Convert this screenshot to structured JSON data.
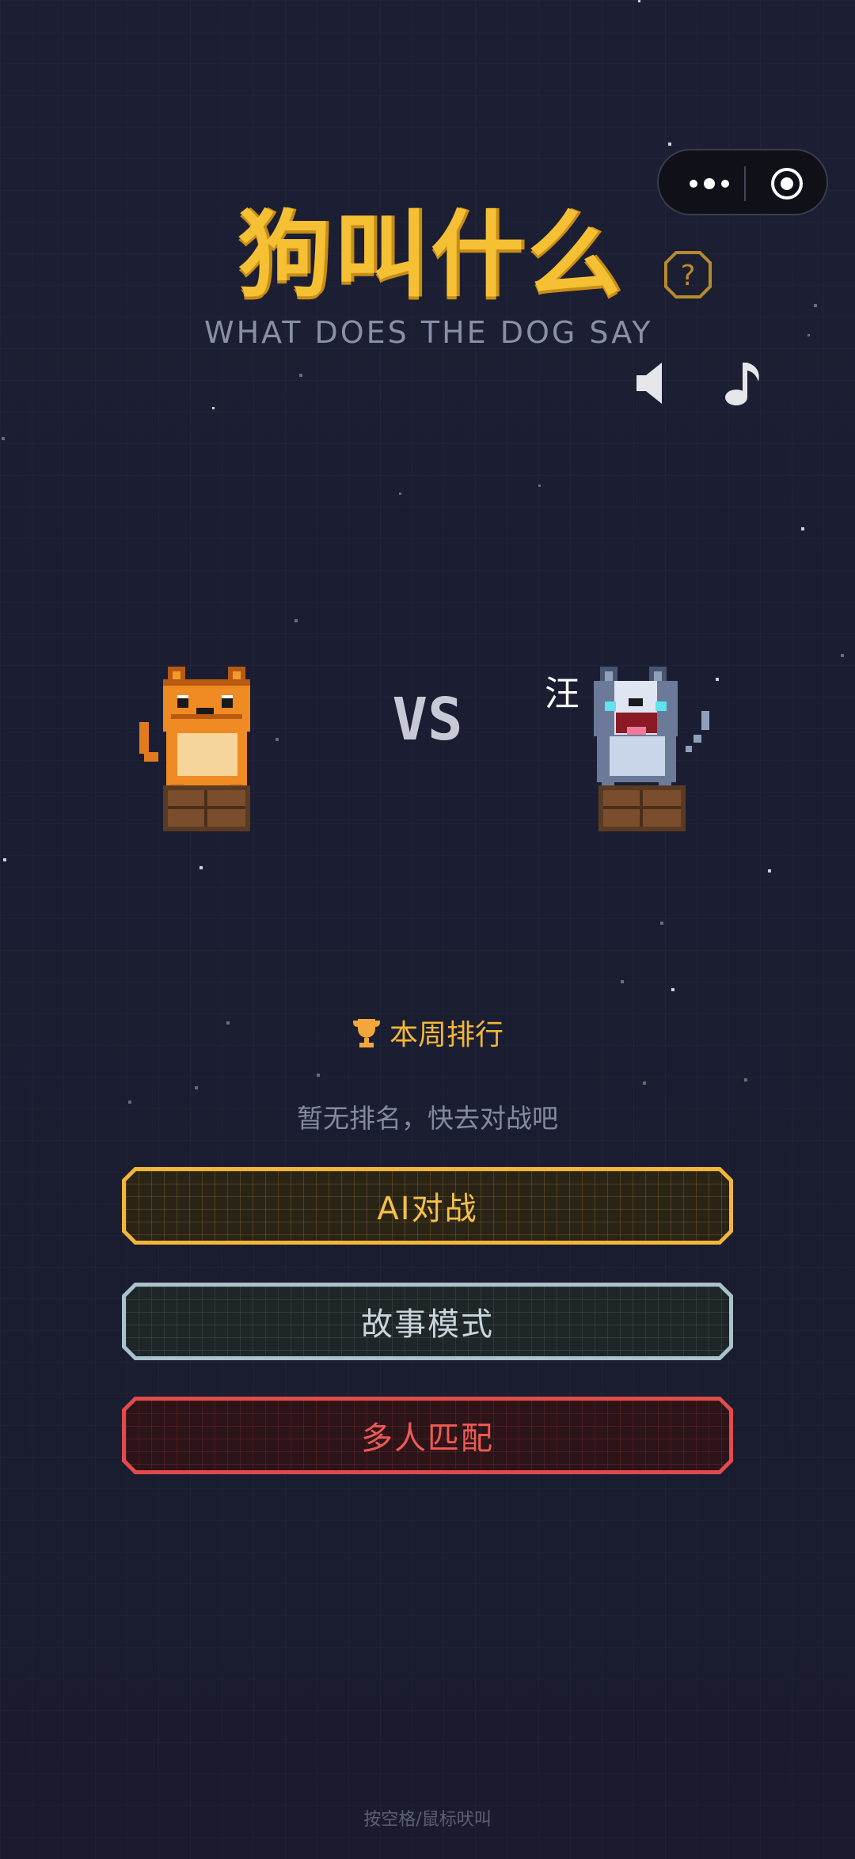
{
  "game": {
    "title": "狗叫什么",
    "subtitle": "WHAT DOES THE DOG SAY",
    "help_icon": "question-mark-icon",
    "speaker_icon": "speaker-icon",
    "music_icon": "music-note-icon"
  },
  "capsule": {
    "more_icon": "more-dots-icon",
    "close_icon": "target-circle-icon"
  },
  "battle": {
    "left_character": "orange-cat",
    "right_character": "husky-dog",
    "vs_label": "VS",
    "bark_text": "汪"
  },
  "ranking": {
    "heading": "本周排行",
    "trophy_icon": "trophy-icon",
    "empty_text": "暂无排名，快去对战吧"
  },
  "buttons": {
    "ai_battle": "AI对战",
    "story_mode": "故事模式",
    "multiplayer": "多人匹配"
  },
  "hint": "按空格/鼠标吠叫",
  "colors": {
    "accent_gold": "#f3b63a",
    "story_border": "#a9c3cc",
    "multi_red": "#e24b4b",
    "background": "#1c1f33"
  }
}
